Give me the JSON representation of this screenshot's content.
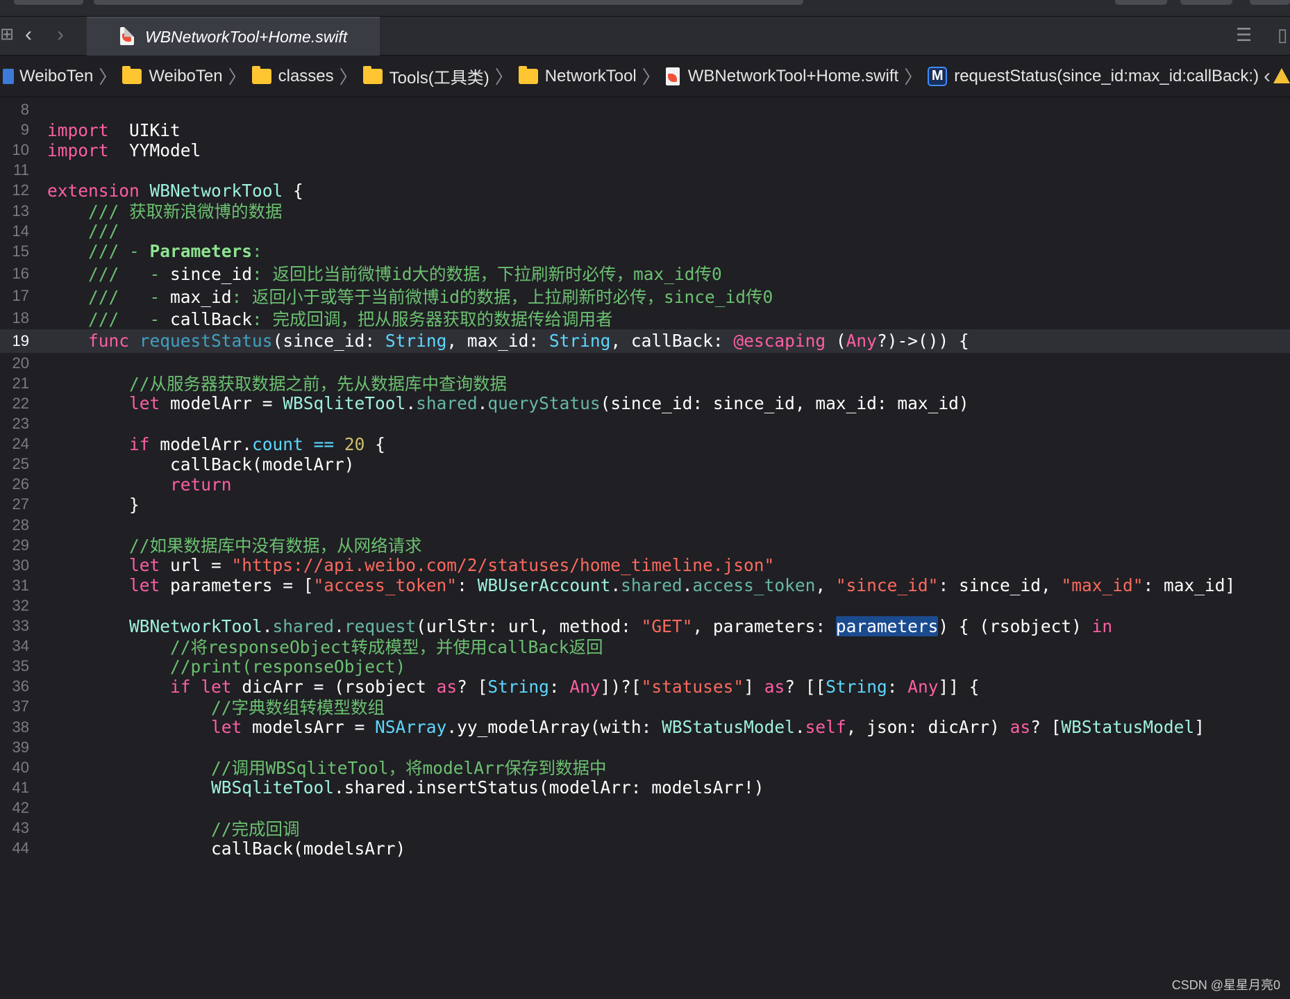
{
  "tab": {
    "filename": "WBNetworkTool+Home.swift"
  },
  "breadcrumb": [
    {
      "label": "WeiboTen",
      "icon": "project-icon"
    },
    {
      "label": "WeiboTen",
      "icon": "folder-icon"
    },
    {
      "label": "classes",
      "icon": "folder-icon"
    },
    {
      "label": "Tools(工具类)",
      "icon": "folder-icon"
    },
    {
      "label": "NetworkTool",
      "icon": "folder-icon"
    },
    {
      "label": "WBNetworkTool+Home.swift",
      "icon": "swift-file-icon"
    },
    {
      "label": "requestStatus(since_id:max_id:callBack:)",
      "icon": "method-icon",
      "badge": "M"
    }
  ],
  "editor": {
    "current_line": 19,
    "lines": [
      {
        "n": "8",
        "tokens": []
      },
      {
        "n": "9",
        "tokens": [
          [
            "kw",
            "import"
          ],
          [
            "",
            "  UIKit"
          ]
        ]
      },
      {
        "n": "10",
        "tokens": [
          [
            "kw",
            "import"
          ],
          [
            "",
            "  YYModel"
          ]
        ]
      },
      {
        "n": "11",
        "tokens": []
      },
      {
        "n": "12",
        "tokens": [
          [
            "kw",
            "extension"
          ],
          [
            "",
            " "
          ],
          [
            "cl",
            "WBNetworkTool"
          ],
          [
            "",
            " {"
          ]
        ]
      },
      {
        "n": "13",
        "tokens": [
          [
            "",
            "    "
          ],
          [
            "cm",
            "/// 获取新浪微博的数据"
          ]
        ]
      },
      {
        "n": "14",
        "tokens": [
          [
            "",
            "    "
          ],
          [
            "cm",
            "///"
          ]
        ]
      },
      {
        "n": "15",
        "tokens": [
          [
            "",
            "    "
          ],
          [
            "cm",
            "/// - "
          ],
          [
            "cmb",
            "Parameters"
          ],
          [
            "cm",
            ":"
          ]
        ]
      },
      {
        "n": "16",
        "tokens": [
          [
            "",
            "    "
          ],
          [
            "cm",
            "///   - "
          ],
          [
            "",
            "since_id"
          ],
          [
            "cm",
            ": 返回比当前微博id大的数据，下拉刷新时必传，max_id传0"
          ]
        ]
      },
      {
        "n": "17",
        "tokens": [
          [
            "",
            "    "
          ],
          [
            "cm",
            "///   - "
          ],
          [
            "",
            "max_id"
          ],
          [
            "cm",
            ": 返回小于或等于当前微博id的数据，上拉刷新时必传，since_id传0"
          ]
        ]
      },
      {
        "n": "18",
        "tokens": [
          [
            "",
            "    "
          ],
          [
            "cm",
            "///   - "
          ],
          [
            "",
            "callBack"
          ],
          [
            "cm",
            ": 完成回调，把从服务器获取的数据传给调用者"
          ]
        ]
      },
      {
        "n": "19",
        "tokens": [
          [
            "",
            "    "
          ],
          [
            "kw",
            "func"
          ],
          [
            "",
            " "
          ],
          [
            "fn",
            "requestStatus"
          ],
          [
            "",
            "(since_id: "
          ],
          [
            "ty",
            "String"
          ],
          [
            "",
            ", max_id: "
          ],
          [
            "ty",
            "String"
          ],
          [
            "",
            ", callBack: "
          ],
          [
            "kw",
            "@escaping"
          ],
          [
            "",
            " ("
          ],
          [
            "kw",
            "Any"
          ],
          [
            "",
            "?)->()) {"
          ]
        ]
      },
      {
        "n": "20",
        "tokens": []
      },
      {
        "n": "21",
        "tokens": [
          [
            "",
            "        "
          ],
          [
            "cm",
            "//从服务器获取数据之前，先从数据库中查询数据"
          ]
        ]
      },
      {
        "n": "22",
        "tokens": [
          [
            "",
            "        "
          ],
          [
            "kw",
            "let"
          ],
          [
            "",
            " modelArr = "
          ],
          [
            "cl",
            "WBSqliteTool"
          ],
          [
            "",
            "."
          ],
          [
            "pj",
            "shared"
          ],
          [
            "",
            "."
          ],
          [
            "pj",
            "queryStatus"
          ],
          [
            "",
            "(since_id: since_id, max_id: max_id)"
          ]
        ]
      },
      {
        "n": "23",
        "tokens": []
      },
      {
        "n": "24",
        "tokens": [
          [
            "",
            "        "
          ],
          [
            "kw",
            "if"
          ],
          [
            "",
            " modelArr."
          ],
          [
            "ty",
            "count"
          ],
          [
            "",
            " "
          ],
          [
            "ty",
            "=="
          ],
          [
            "",
            " "
          ],
          [
            "num",
            "20"
          ],
          [
            "",
            " {"
          ]
        ]
      },
      {
        "n": "25",
        "tokens": [
          [
            "",
            "            callBack(modelArr)"
          ]
        ]
      },
      {
        "n": "26",
        "tokens": [
          [
            "",
            "            "
          ],
          [
            "kw",
            "return"
          ]
        ]
      },
      {
        "n": "27",
        "tokens": [
          [
            "",
            "        }"
          ]
        ]
      },
      {
        "n": "28",
        "tokens": []
      },
      {
        "n": "29",
        "tokens": [
          [
            "",
            "        "
          ],
          [
            "cm",
            "//如果数据库中没有数据，从网络请求"
          ]
        ]
      },
      {
        "n": "30",
        "tokens": [
          [
            "",
            "        "
          ],
          [
            "kw",
            "let"
          ],
          [
            "",
            " url = "
          ],
          [
            "str",
            "\"https://api.weibo.com/2/statuses/home_timeline.json\""
          ]
        ]
      },
      {
        "n": "31",
        "tokens": [
          [
            "",
            "        "
          ],
          [
            "kw",
            "let"
          ],
          [
            "",
            " parameters = ["
          ],
          [
            "str",
            "\"access_token\""
          ],
          [
            "",
            ": "
          ],
          [
            "cl",
            "WBUserAccount"
          ],
          [
            "",
            "."
          ],
          [
            "pj",
            "shared"
          ],
          [
            "",
            "."
          ],
          [
            "pj",
            "access_token"
          ],
          [
            "",
            ", "
          ],
          [
            "str",
            "\"since_id\""
          ],
          [
            "",
            ": since_id, "
          ],
          [
            "str",
            "\"max_id\""
          ],
          [
            "",
            ": max_id]"
          ]
        ]
      },
      {
        "n": "32",
        "tokens": []
      },
      {
        "n": "33",
        "tokens": [
          [
            "",
            "        "
          ],
          [
            "cl",
            "WBNetworkTool"
          ],
          [
            "",
            "."
          ],
          [
            "pj",
            "shared"
          ],
          [
            "",
            "."
          ],
          [
            "pj",
            "request"
          ],
          [
            "",
            "(urlStr: url, method: "
          ],
          [
            "str",
            "\"GET\""
          ],
          [
            "",
            ", parameters: "
          ],
          [
            "sel",
            "parameters"
          ],
          [
            "",
            ") { (rsobject) "
          ],
          [
            "kw",
            "in"
          ]
        ]
      },
      {
        "n": "34",
        "tokens": [
          [
            "",
            "            "
          ],
          [
            "cm",
            "//将responseObject转成模型，并使用callBack返回"
          ]
        ]
      },
      {
        "n": "35",
        "tokens": [
          [
            "",
            "            "
          ],
          [
            "cm",
            "//print(responseObject)"
          ]
        ]
      },
      {
        "n": "36",
        "tokens": [
          [
            "",
            "            "
          ],
          [
            "kw",
            "if"
          ],
          [
            "",
            " "
          ],
          [
            "kw",
            "let"
          ],
          [
            "",
            " dicArr = (rsobject "
          ],
          [
            "kw",
            "as"
          ],
          [
            "",
            "? ["
          ],
          [
            "ty",
            "String"
          ],
          [
            "",
            ": "
          ],
          [
            "kw",
            "Any"
          ],
          [
            "",
            "])?["
          ],
          [
            "str",
            "\"statuses\""
          ],
          [
            "",
            "] "
          ],
          [
            "kw",
            "as"
          ],
          [
            "",
            "? [["
          ],
          [
            "ty",
            "String"
          ],
          [
            "",
            ": "
          ],
          [
            "kw",
            "Any"
          ],
          [
            "",
            "]] {"
          ]
        ]
      },
      {
        "n": "37",
        "tokens": [
          [
            "",
            "                "
          ],
          [
            "cm",
            "//字典数组转模型数组"
          ]
        ]
      },
      {
        "n": "38",
        "tokens": [
          [
            "",
            "                "
          ],
          [
            "kw",
            "let"
          ],
          [
            "",
            " modelsArr = "
          ],
          [
            "ty",
            "NSArray"
          ],
          [
            "",
            ".yy_modelArray(with: "
          ],
          [
            "cl",
            "WBStatusModel"
          ],
          [
            "",
            "."
          ],
          [
            "kw",
            "self"
          ],
          [
            "",
            ", json: dicArr) "
          ],
          [
            "kw",
            "as"
          ],
          [
            "",
            "? ["
          ],
          [
            "cl",
            "WBStatusModel"
          ],
          [
            "",
            "]"
          ]
        ]
      },
      {
        "n": "39",
        "tokens": []
      },
      {
        "n": "40",
        "tokens": [
          [
            "",
            "                "
          ],
          [
            "cm",
            "//调用WBSqliteTool，将modelArr保存到数据中"
          ]
        ]
      },
      {
        "n": "41",
        "tokens": [
          [
            "",
            "                "
          ],
          [
            "cl",
            "WBSqliteTool"
          ],
          [
            "",
            ".shared.insertStatus(modelArr: modelsArr!)"
          ]
        ]
      },
      {
        "n": "42",
        "tokens": []
      },
      {
        "n": "43",
        "tokens": [
          [
            "",
            "                "
          ],
          [
            "cm",
            "//完成回调"
          ]
        ]
      },
      {
        "n": "44",
        "tokens": [
          [
            "",
            "                callBack(modelsArr)"
          ]
        ]
      }
    ]
  },
  "watermark": "CSDN @星星月亮0",
  "colors": {
    "keyword": "#fc5fa3",
    "type": "#5dd8ff",
    "class": "#9ef1dd",
    "project": "#67b7a4",
    "string": "#fc6a5d",
    "number": "#d0bf69",
    "comment": "#6cc070",
    "background": "#1f1f24",
    "current_line": "#2f3036"
  }
}
